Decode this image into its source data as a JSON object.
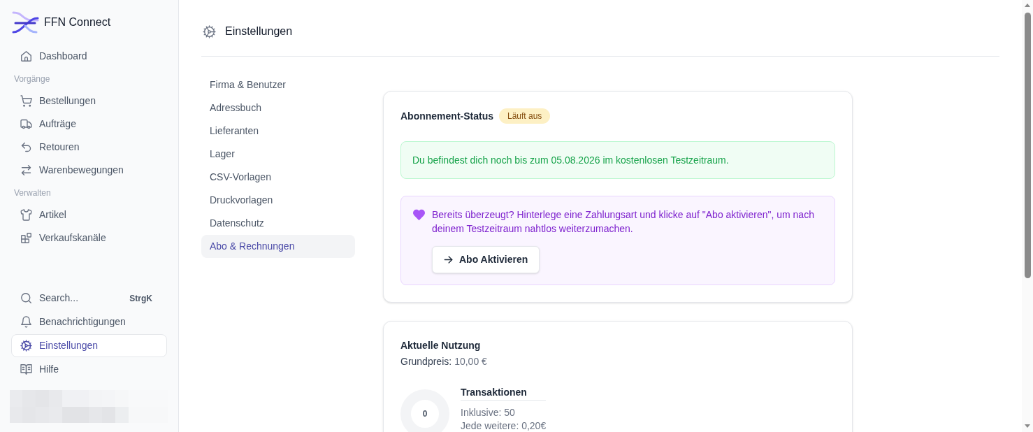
{
  "app": {
    "name": "FFN Connect"
  },
  "sidebar": {
    "groups": [
      {
        "items": [
          {
            "label": "Dashboard",
            "selected": false
          }
        ]
      },
      {
        "heading": "Vorgänge",
        "items": [
          {
            "label": "Bestellungen",
            "selected": false
          },
          {
            "label": "Aufträge",
            "selected": false
          },
          {
            "label": "Retouren",
            "selected": false
          },
          {
            "label": "Warenbewegungen",
            "selected": false
          }
        ]
      },
      {
        "heading": "Verwalten",
        "items": [
          {
            "label": "Artikel",
            "selected": false
          },
          {
            "label": "Verkaufskanäle",
            "selected": false
          }
        ]
      }
    ],
    "footer_items": [
      {
        "kind": "search",
        "label": "Search...",
        "shortcut": "StrgK",
        "selected": false
      },
      {
        "kind": "link",
        "label": "Benachrichtigungen",
        "selected": false
      },
      {
        "kind": "link",
        "label": "Einstellungen",
        "selected": true
      },
      {
        "kind": "link",
        "label": "Hilfe",
        "selected": false
      }
    ]
  },
  "page": {
    "title": "Einstellungen"
  },
  "settings_nav": [
    {
      "label": "Firma & Benutzer",
      "selected": false
    },
    {
      "label": "Adressbuch",
      "selected": false
    },
    {
      "label": "Lieferanten",
      "selected": false
    },
    {
      "label": "Lager",
      "selected": false
    },
    {
      "label": "CSV-Vorlagen",
      "selected": false
    },
    {
      "label": "Druckvorlagen",
      "selected": false
    },
    {
      "label": "Datenschutz",
      "selected": false
    },
    {
      "label": "Abo & Rechnungen",
      "selected": true
    }
  ],
  "subscription_card": {
    "title": "Abonnement-Status",
    "badge": "Läuft aus",
    "notice": "Du befindest dich noch bis zum 05.08.2026 im kostenlosen Testzeitraum.",
    "promo": {
      "text": "Bereits überzeugt? Hinterlege eine Zahlungsart und klicke auf \"Abo aktivieren\", um nach deinem Testzeitraum nahtlos weiterzumachen.",
      "button": "Abo Aktivieren"
    }
  },
  "usage_card": {
    "title": "Aktuelle Nutzung",
    "base_price": {
      "label": "Grundpreis:",
      "value": "10,00 €"
    },
    "meters": [
      {
        "title": "Transaktionen",
        "count": "0",
        "level": 0,
        "lines": [
          "Inklusive: 50",
          "Jede weitere: 0,20€"
        ]
      }
    ]
  }
}
